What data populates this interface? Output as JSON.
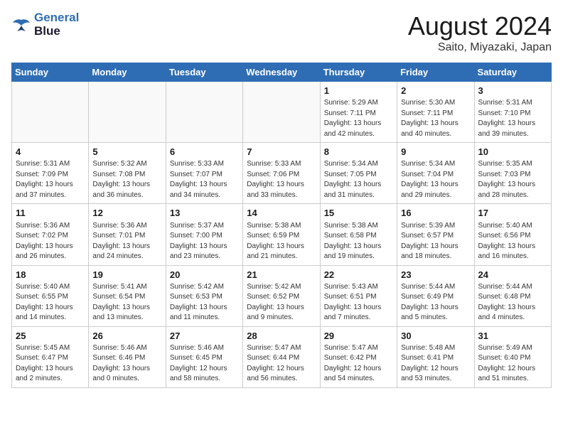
{
  "header": {
    "logo_line1": "General",
    "logo_line2": "Blue",
    "title": "August 2024",
    "subtitle": "Saito, Miyazaki, Japan"
  },
  "weekdays": [
    "Sunday",
    "Monday",
    "Tuesday",
    "Wednesday",
    "Thursday",
    "Friday",
    "Saturday"
  ],
  "weeks": [
    [
      {
        "day": "",
        "info": ""
      },
      {
        "day": "",
        "info": ""
      },
      {
        "day": "",
        "info": ""
      },
      {
        "day": "",
        "info": ""
      },
      {
        "day": "1",
        "info": "Sunrise: 5:29 AM\nSunset: 7:11 PM\nDaylight: 13 hours\nand 42 minutes."
      },
      {
        "day": "2",
        "info": "Sunrise: 5:30 AM\nSunset: 7:11 PM\nDaylight: 13 hours\nand 40 minutes."
      },
      {
        "day": "3",
        "info": "Sunrise: 5:31 AM\nSunset: 7:10 PM\nDaylight: 13 hours\nand 39 minutes."
      }
    ],
    [
      {
        "day": "4",
        "info": "Sunrise: 5:31 AM\nSunset: 7:09 PM\nDaylight: 13 hours\nand 37 minutes."
      },
      {
        "day": "5",
        "info": "Sunrise: 5:32 AM\nSunset: 7:08 PM\nDaylight: 13 hours\nand 36 minutes."
      },
      {
        "day": "6",
        "info": "Sunrise: 5:33 AM\nSunset: 7:07 PM\nDaylight: 13 hours\nand 34 minutes."
      },
      {
        "day": "7",
        "info": "Sunrise: 5:33 AM\nSunset: 7:06 PM\nDaylight: 13 hours\nand 33 minutes."
      },
      {
        "day": "8",
        "info": "Sunrise: 5:34 AM\nSunset: 7:05 PM\nDaylight: 13 hours\nand 31 minutes."
      },
      {
        "day": "9",
        "info": "Sunrise: 5:34 AM\nSunset: 7:04 PM\nDaylight: 13 hours\nand 29 minutes."
      },
      {
        "day": "10",
        "info": "Sunrise: 5:35 AM\nSunset: 7:03 PM\nDaylight: 13 hours\nand 28 minutes."
      }
    ],
    [
      {
        "day": "11",
        "info": "Sunrise: 5:36 AM\nSunset: 7:02 PM\nDaylight: 13 hours\nand 26 minutes."
      },
      {
        "day": "12",
        "info": "Sunrise: 5:36 AM\nSunset: 7:01 PM\nDaylight: 13 hours\nand 24 minutes."
      },
      {
        "day": "13",
        "info": "Sunrise: 5:37 AM\nSunset: 7:00 PM\nDaylight: 13 hours\nand 23 minutes."
      },
      {
        "day": "14",
        "info": "Sunrise: 5:38 AM\nSunset: 6:59 PM\nDaylight: 13 hours\nand 21 minutes."
      },
      {
        "day": "15",
        "info": "Sunrise: 5:38 AM\nSunset: 6:58 PM\nDaylight: 13 hours\nand 19 minutes."
      },
      {
        "day": "16",
        "info": "Sunrise: 5:39 AM\nSunset: 6:57 PM\nDaylight: 13 hours\nand 18 minutes."
      },
      {
        "day": "17",
        "info": "Sunrise: 5:40 AM\nSunset: 6:56 PM\nDaylight: 13 hours\nand 16 minutes."
      }
    ],
    [
      {
        "day": "18",
        "info": "Sunrise: 5:40 AM\nSunset: 6:55 PM\nDaylight: 13 hours\nand 14 minutes."
      },
      {
        "day": "19",
        "info": "Sunrise: 5:41 AM\nSunset: 6:54 PM\nDaylight: 13 hours\nand 13 minutes."
      },
      {
        "day": "20",
        "info": "Sunrise: 5:42 AM\nSunset: 6:53 PM\nDaylight: 13 hours\nand 11 minutes."
      },
      {
        "day": "21",
        "info": "Sunrise: 5:42 AM\nSunset: 6:52 PM\nDaylight: 13 hours\nand 9 minutes."
      },
      {
        "day": "22",
        "info": "Sunrise: 5:43 AM\nSunset: 6:51 PM\nDaylight: 13 hours\nand 7 minutes."
      },
      {
        "day": "23",
        "info": "Sunrise: 5:44 AM\nSunset: 6:49 PM\nDaylight: 13 hours\nand 5 minutes."
      },
      {
        "day": "24",
        "info": "Sunrise: 5:44 AM\nSunset: 6:48 PM\nDaylight: 13 hours\nand 4 minutes."
      }
    ],
    [
      {
        "day": "25",
        "info": "Sunrise: 5:45 AM\nSunset: 6:47 PM\nDaylight: 13 hours\nand 2 minutes."
      },
      {
        "day": "26",
        "info": "Sunrise: 5:46 AM\nSunset: 6:46 PM\nDaylight: 13 hours\nand 0 minutes."
      },
      {
        "day": "27",
        "info": "Sunrise: 5:46 AM\nSunset: 6:45 PM\nDaylight: 12 hours\nand 58 minutes."
      },
      {
        "day": "28",
        "info": "Sunrise: 5:47 AM\nSunset: 6:44 PM\nDaylight: 12 hours\nand 56 minutes."
      },
      {
        "day": "29",
        "info": "Sunrise: 5:47 AM\nSunset: 6:42 PM\nDaylight: 12 hours\nand 54 minutes."
      },
      {
        "day": "30",
        "info": "Sunrise: 5:48 AM\nSunset: 6:41 PM\nDaylight: 12 hours\nand 53 minutes."
      },
      {
        "day": "31",
        "info": "Sunrise: 5:49 AM\nSunset: 6:40 PM\nDaylight: 12 hours\nand 51 minutes."
      }
    ]
  ]
}
